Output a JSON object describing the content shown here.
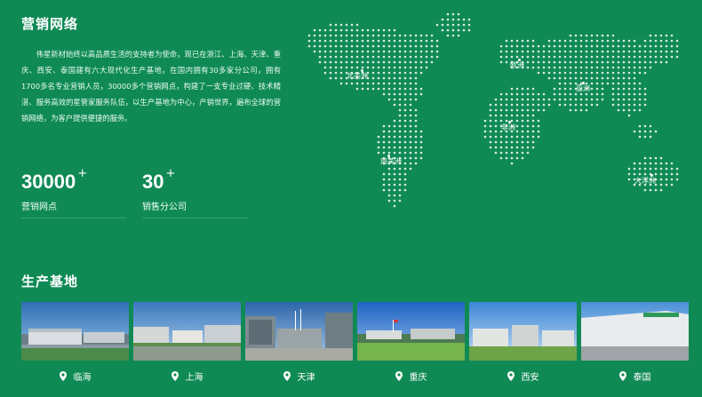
{
  "network": {
    "title": "营销网络",
    "intro": "伟星新材始终以高品质生活的支持者为使命，现已在浙江、上海、天津、重庆、西安、泰国建有六大现代化生产基地，在国内拥有30多家分公司，拥有1700多名专业营销人员，30000多个营销网点，构建了一支专业过硬、技术精湛、服务高效的星管家服务队伍，以生产基地为中心，产销世界，遍布全球的营销网络，为客户提供便捷的服务。",
    "stats": [
      {
        "value": "30000",
        "suffix": "+",
        "label": "营销网点"
      },
      {
        "value": "30",
        "suffix": "+",
        "label": "销售分公司"
      }
    ]
  },
  "map": {
    "regions": [
      "北美洲",
      "欧洲",
      "亚洲",
      "非洲",
      "南美洲",
      "大洋洲"
    ]
  },
  "production": {
    "title": "生产基地",
    "bases": [
      "临海",
      "上海",
      "天津",
      "重庆",
      "西安",
      "泰国"
    ]
  },
  "colors": {
    "background": "#0f8a55",
    "text": "#ffffff"
  }
}
